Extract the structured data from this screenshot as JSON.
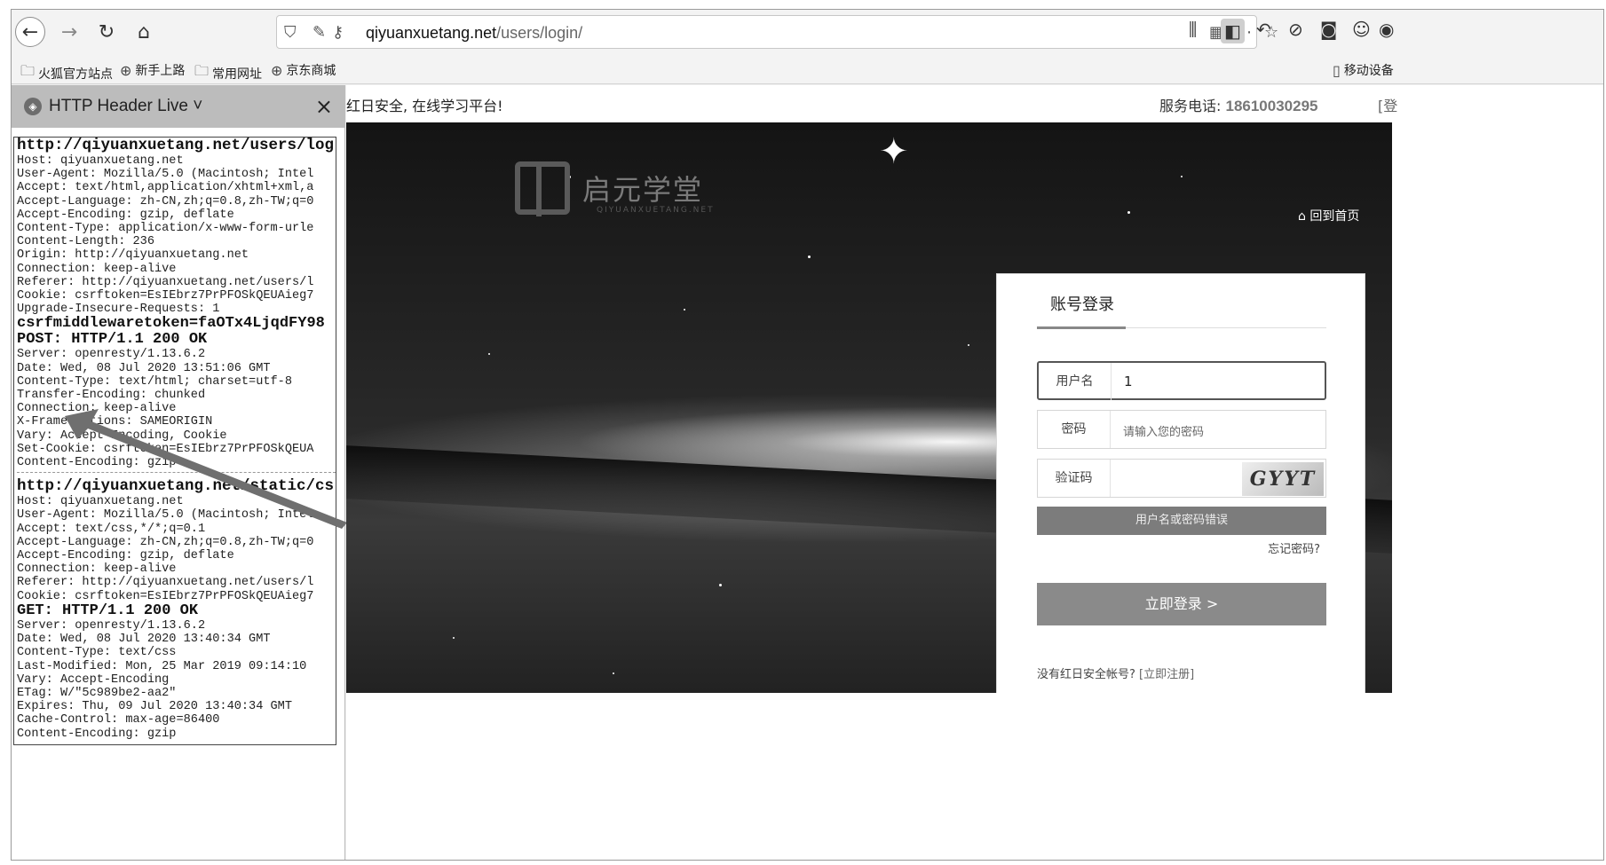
{
  "browser": {
    "url_host": "qiyuanxuetang.net",
    "url_path": "/users/login/",
    "bookmarks": [
      "火狐官方站点",
      "新手上路",
      "常用网址",
      "京东商城"
    ],
    "bookmark_right": "移动设备"
  },
  "sidebar": {
    "title": "HTTP Header Live ˅",
    "close": "×",
    "request1": {
      "url": "http://qiyuanxuetang.net/users/log",
      "headers": [
        "Host: qiyuanxuetang.net",
        "User-Agent: Mozilla/5.0 (Macintosh; Intel",
        "Accept: text/html,application/xhtml+xml,a",
        "Accept-Language: zh-CN,zh;q=0.8,zh-TW;q=0",
        "Accept-Encoding: gzip, deflate",
        "Content-Type: application/x-www-form-urle",
        "Content-Length: 236",
        "Origin: http://qiyuanxuetang.net",
        "Connection: keep-alive",
        "Referer: http://qiyuanxuetang.net/users/l",
        "Cookie: csrftoken=EsIEbrz7PrPFOSkQEUAieg7",
        "Upgrade-Insecure-Requests: 1"
      ],
      "body": "csrfmiddlewaretoken=faOTx4LjqdFY98",
      "status": "POST: HTTP/1.1 200 OK",
      "response": [
        "Server: openresty/1.13.6.2",
        "Date: Wed, 08 Jul 2020 13:51:06 GMT",
        "Content-Type: text/html; charset=utf-8",
        "Transfer-Encoding: chunked",
        "Connection: keep-alive",
        "X-Frame-Options: SAMEORIGIN",
        "Vary: Accept-Encoding, Cookie",
        "Set-Cookie: csrftoken=EsIEbrz7PrPFOSkQEUA",
        "Content-Encoding: gzip"
      ]
    },
    "request2": {
      "url": "http://qiyuanxuetang.net/static/cs",
      "headers": [
        "Host: qiyuanxuetang.net",
        "User-Agent: Mozilla/5.0 (Macintosh; Intel",
        "Accept: text/css,*/*;q=0.1",
        "Accept-Language: zh-CN,zh;q=0.8,zh-TW;q=0",
        "Accept-Encoding: gzip, deflate",
        "Connection: keep-alive",
        "Referer: http://qiyuanxuetang.net/users/l",
        "Cookie: csrftoken=EsIEbrz7PrPFOSkQEUAieg7"
      ],
      "status": "GET: HTTP/1.1 200 OK",
      "response": [
        "Server: openresty/1.13.6.2",
        "Date: Wed, 08 Jul 2020 13:40:34 GMT",
        "Content-Type: text/css",
        "Last-Modified: Mon, 25 Mar 2019 09:14:10",
        "Vary: Accept-Encoding",
        "ETag: W/\"5c989be2-aa2\"",
        "Expires: Thu, 09 Jul 2020 13:40:34 GMT",
        "Cache-Control: max-age=86400",
        "Content-Encoding: gzip"
      ]
    }
  },
  "page": {
    "slogan": "红日安全, 在线学习平台!",
    "phone_label": "服务电话: ",
    "phone": "18610030295",
    "login_link": "[登",
    "brand_name": "启元学堂",
    "brand_sub": "QIYUANXUETANG.NET",
    "home_link": "回到首页",
    "form": {
      "tab": "账号登录",
      "username_label": "用户名",
      "username_value": "1",
      "password_label": "密码",
      "password_placeholder": "请输入您的密码",
      "captcha_label": "验证码",
      "captcha_text": "GYYT",
      "error": "用户名或密码错误",
      "forgot": "忘记密码?",
      "submit": "立即登录 >",
      "register_prompt": "没有红日安全帐号? ",
      "register_link": "[立即注册]"
    }
  }
}
